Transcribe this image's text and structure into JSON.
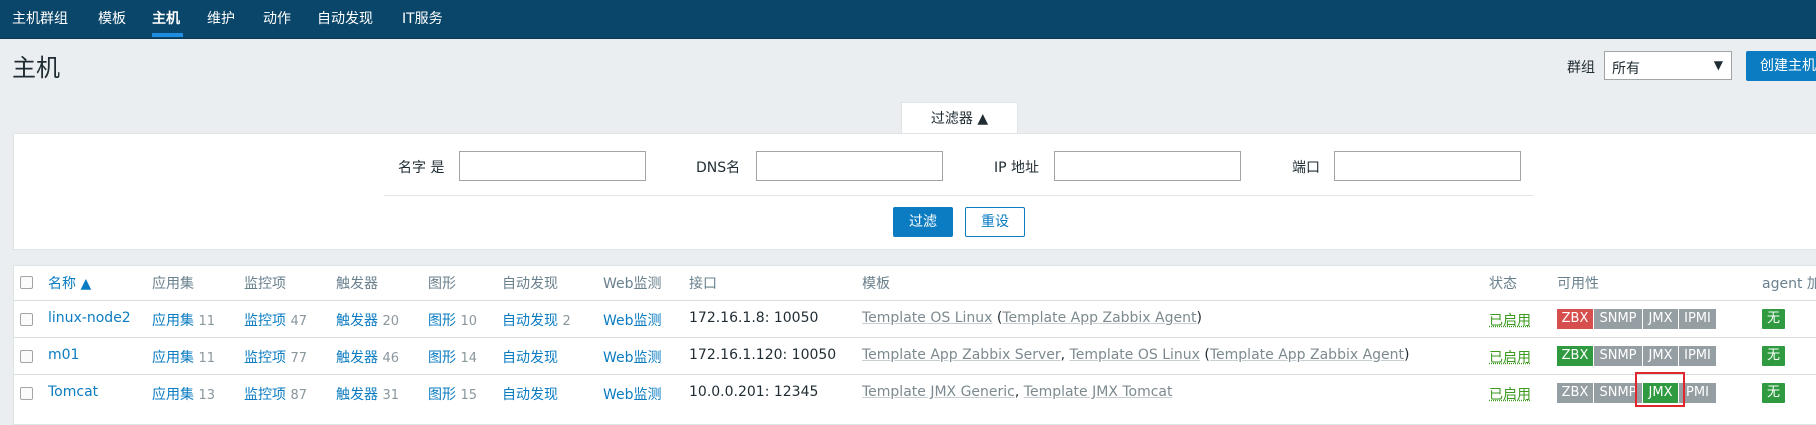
{
  "nav": {
    "items": [
      "主机群组",
      "模板",
      "主机",
      "维护",
      "动作",
      "自动发现",
      "IT服务"
    ],
    "active": "主机"
  },
  "page": {
    "title": "主机",
    "group_label": "群组",
    "group_value": "所有",
    "create_button": "创建主机"
  },
  "filter": {
    "tab_label": "过滤器 ▲",
    "name_label": "名字 是",
    "dns_label": "DNS名",
    "ip_label": "IP 地址",
    "port_label": "端口",
    "apply_button": "过滤",
    "reset_button": "重设"
  },
  "table": {
    "headers": {
      "name": "名称 ▲",
      "apps": "应用集",
      "items": "监控项",
      "triggers": "触发器",
      "graphs": "图形",
      "discovery": "自动发现",
      "web": "Web监测",
      "interface": "接口",
      "templates": "模板",
      "status": "状态",
      "availability": "可用性",
      "agent_encryption": "agent 加"
    },
    "rows": [
      {
        "name": "linux-node2",
        "apps_label": "应用集",
        "apps_count": "11",
        "items_label": "监控项",
        "items_count": "47",
        "triggers_label": "触发器",
        "triggers_count": "20",
        "graphs_label": "图形",
        "graphs_count": "10",
        "discovery_label": "自动发现",
        "discovery_count": "2",
        "web_label": "Web监测",
        "interface": "172.16.1.8: 10050",
        "tpl_main": "Template OS Linux",
        "tpl_sep": "",
        "tpl_second": "",
        "tpl_open": " (",
        "tpl_linked": "Template App Zabbix Agent",
        "tpl_close": ")",
        "status": "已启用",
        "zbx": "ZBX",
        "snmp": "SNMP",
        "jmx": "JMX",
        "ipmi": "IPMI",
        "agent": "无"
      },
      {
        "name": "m01",
        "apps_label": "应用集",
        "apps_count": "11",
        "items_label": "监控项",
        "items_count": "77",
        "triggers_label": "触发器",
        "triggers_count": "46",
        "graphs_label": "图形",
        "graphs_count": "14",
        "discovery_label": "自动发现",
        "discovery_count": "",
        "web_label": "Web监测",
        "interface": "172.16.1.120: 10050",
        "tpl_main": "Template App Zabbix Server",
        "tpl_sep": ", ",
        "tpl_second": "Template OS Linux",
        "tpl_open": " (",
        "tpl_linked": "Template App Zabbix Agent",
        "tpl_close": ")",
        "status": "已启用",
        "zbx": "ZBX",
        "snmp": "SNMP",
        "jmx": "JMX",
        "ipmi": "IPMI",
        "agent": "无"
      },
      {
        "name": "Tomcat",
        "apps_label": "应用集",
        "apps_count": "13",
        "items_label": "监控项",
        "items_count": "87",
        "triggers_label": "触发器",
        "triggers_count": "31",
        "graphs_label": "图形",
        "graphs_count": "15",
        "discovery_label": "自动发现",
        "discovery_count": "",
        "web_label": "Web监测",
        "interface": "10.0.0.201: 12345",
        "tpl_main": "Template JMX Generic",
        "tpl_sep": ", ",
        "tpl_second": "Template JMX Tomcat",
        "tpl_open": "",
        "tpl_linked": "",
        "tpl_close": "",
        "status": "已启用",
        "zbx": "ZBX",
        "snmp": "SNMP",
        "jmx": "JMX",
        "ipmi": "PMI",
        "agent": "无"
      }
    ]
  },
  "colors": {
    "nav_bg": "#0a466a",
    "link": "#0b7cc1",
    "enabled": "#3b9a1f",
    "available": "#2f9a40",
    "unavailable": "#d64e4e",
    "unknown": "#959ea3",
    "highlight": "#e0262b"
  }
}
